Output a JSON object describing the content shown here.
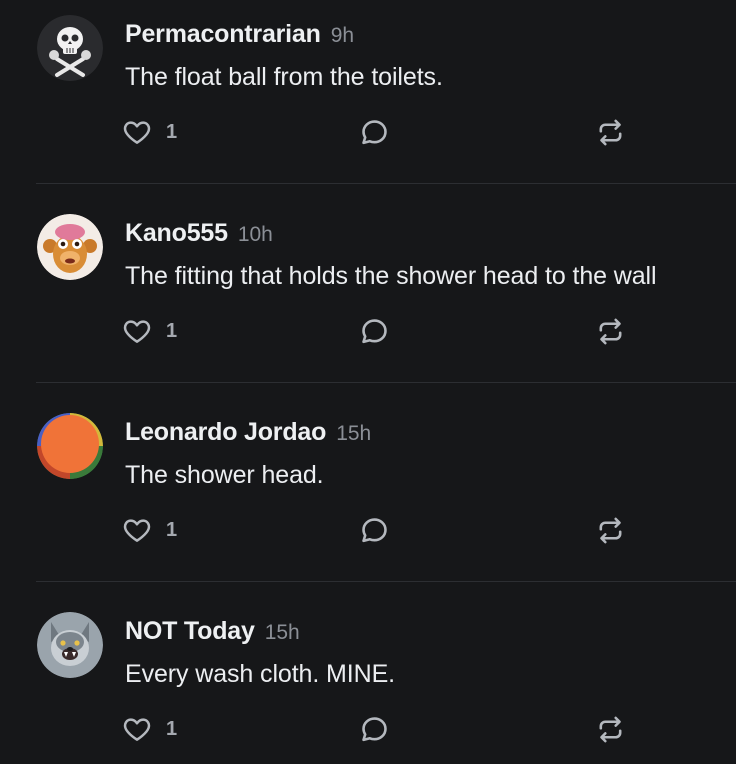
{
  "colors": {
    "background": "#161719",
    "divider": "#2c2e32",
    "icon": "#b4b8be",
    "username": "#eef0f2",
    "timestamp": "#8b8f96"
  },
  "posts": [
    {
      "username": "Permacontrarian",
      "time": "9h",
      "text": "The float ball from the toilets.",
      "likes": "1",
      "avatar_icon": "skull-crossbones-avatar"
    },
    {
      "username": "Kano555",
      "time": "10h",
      "text": "The fitting that holds the shower head to the wall",
      "likes": "1",
      "avatar_icon": "cartoon-monkey-avatar"
    },
    {
      "username": "Leonardo Jordao",
      "time": "15h",
      "text": "The shower head.",
      "likes": "1",
      "avatar_icon": "orange-circle-avatar"
    },
    {
      "username": "NOT Today",
      "time": "15h",
      "text": "Every wash cloth. MINE.",
      "likes": "1",
      "avatar_icon": "wolf-avatar"
    }
  ]
}
